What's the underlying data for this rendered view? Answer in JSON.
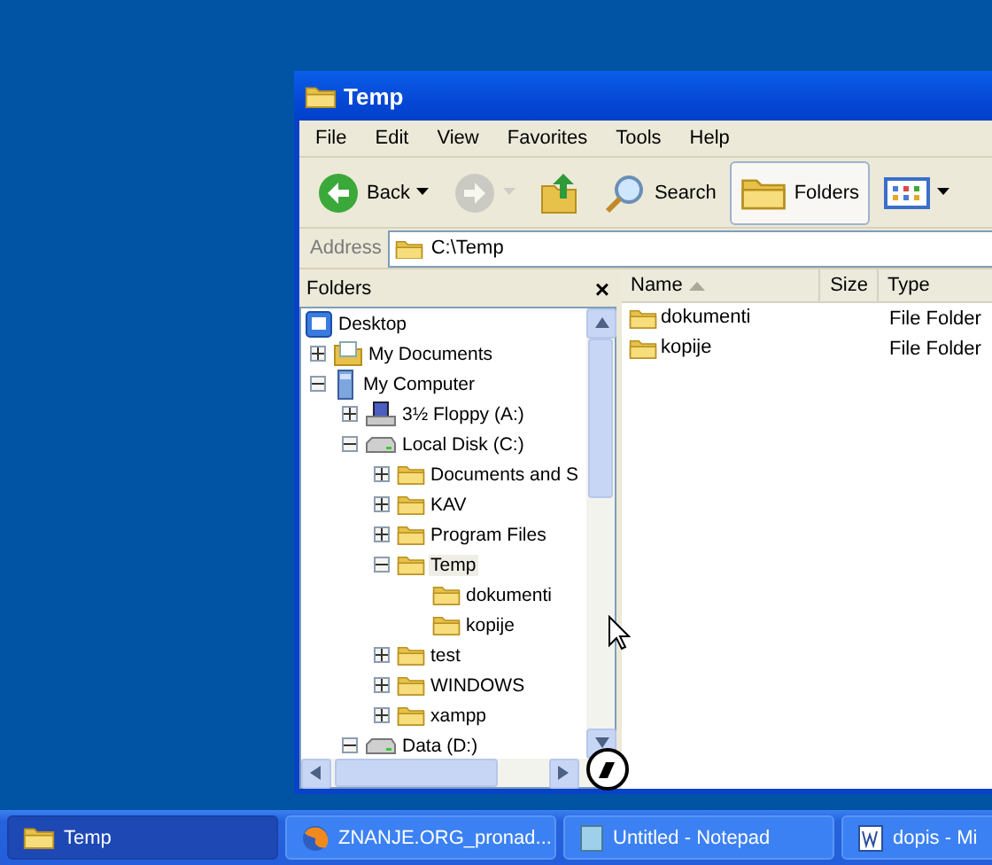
{
  "window": {
    "title": "Temp"
  },
  "menu": [
    "File",
    "Edit",
    "View",
    "Favorites",
    "Tools",
    "Help"
  ],
  "toolbar": [
    {
      "kind": "back",
      "label": "Back",
      "disabled": false,
      "selected": false
    },
    {
      "kind": "forward",
      "disabled": true,
      "selected": false
    },
    {
      "kind": "up",
      "disabled": false,
      "selected": false
    },
    {
      "kind": "search",
      "label": "Search",
      "disabled": false,
      "selected": false
    },
    {
      "kind": "folders",
      "label": "Folders",
      "disabled": false,
      "selected": true
    },
    {
      "kind": "views",
      "disabled": false,
      "selected": false
    }
  ],
  "address": {
    "label": "Address",
    "value": "C:\\Temp"
  },
  "folders_pane": {
    "title": "Folders",
    "close": "×",
    "tree": [
      {
        "label": "Desktop",
        "kind": "desktop",
        "selected": false,
        "children": [
          {
            "label": "My Documents",
            "kind": "documents",
            "expanded": false,
            "selected": false
          },
          {
            "label": "My Computer",
            "kind": "computer",
            "expanded": true,
            "selected": false,
            "children": [
              {
                "label": "3½ Floppy (A:)",
                "kind": "floppy",
                "expanded": false,
                "selected": false
              },
              {
                "label": "Local Disk (C:)",
                "kind": "drive",
                "expanded": true,
                "selected": false,
                "children": [
                  {
                    "label": "Documents and S",
                    "kind": "folder",
                    "expanded": false,
                    "selected": false
                  },
                  {
                    "label": "KAV",
                    "kind": "folder",
                    "expanded": false,
                    "selected": false
                  },
                  {
                    "label": "Program Files",
                    "kind": "folder",
                    "expanded": false,
                    "selected": false
                  },
                  {
                    "label": "Temp",
                    "kind": "folder",
                    "expanded": true,
                    "selected": true,
                    "children": [
                      {
                        "label": "dokumenti",
                        "kind": "folder",
                        "selected": false
                      },
                      {
                        "label": "kopije",
                        "kind": "folder",
                        "selected": false
                      }
                    ]
                  },
                  {
                    "label": "test",
                    "kind": "folder",
                    "expanded": false,
                    "selected": false
                  },
                  {
                    "label": "WINDOWS",
                    "kind": "folder",
                    "expanded": false,
                    "selected": false
                  },
                  {
                    "label": "xampp",
                    "kind": "folder",
                    "expanded": false,
                    "selected": false
                  }
                ]
              },
              {
                "label": "Data (D:)",
                "kind": "drive",
                "expanded": true,
                "selected": false
              }
            ]
          }
        ]
      }
    ]
  },
  "file_list": {
    "columns": [
      "Name",
      "Size",
      "Type"
    ],
    "rows": [
      {
        "name": "dokumenti",
        "type": "File Folder"
      },
      {
        "name": "kopije",
        "type": "File Folder"
      }
    ]
  },
  "taskbar": [
    {
      "label": "Temp",
      "kind": "explorer",
      "selected": true
    },
    {
      "label": "ZNANJE.ORG_pronad...",
      "kind": "browser",
      "selected": false
    },
    {
      "label": "Untitled - Notepad",
      "kind": "notepad",
      "selected": false
    },
    {
      "label": "dopis - Mi",
      "kind": "word",
      "selected": false
    }
  ]
}
